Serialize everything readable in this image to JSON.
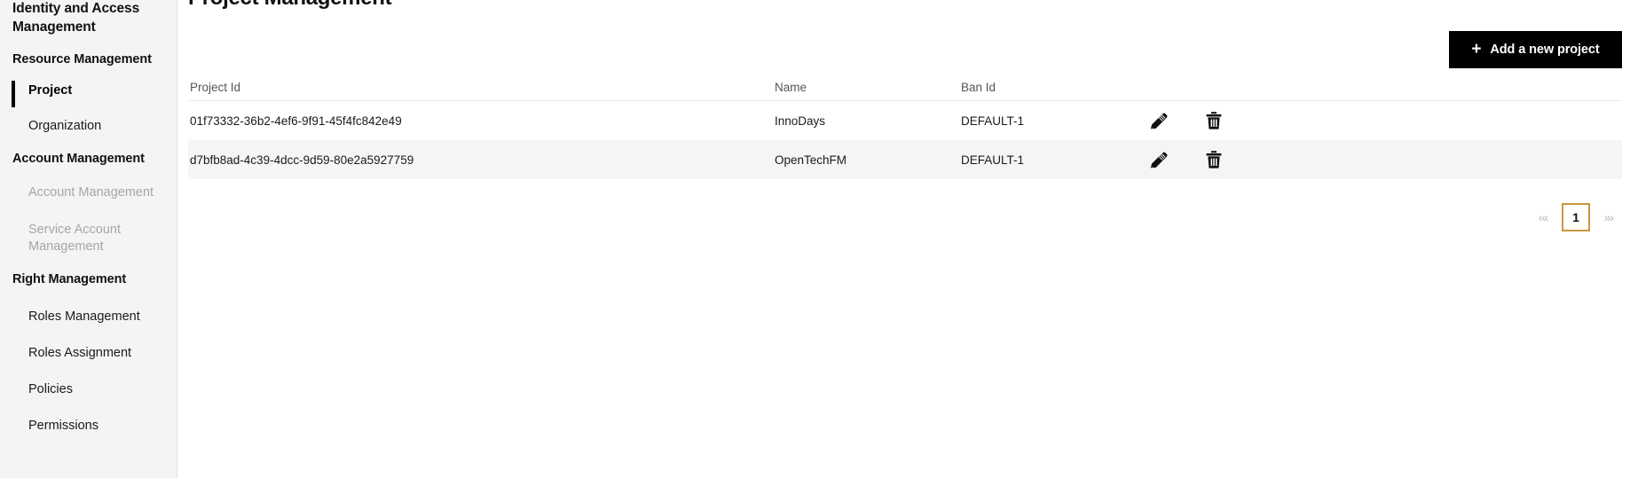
{
  "sidebar": {
    "title": "Identity and Access Management",
    "sections": [
      {
        "label": "Resource Management",
        "items": [
          {
            "label": "Project",
            "state": "active"
          },
          {
            "label": "Organization",
            "state": "muted"
          }
        ]
      },
      {
        "label": "Account Management",
        "items": [
          {
            "label": "Account Management",
            "state": "disabled"
          },
          {
            "label": "Service Account Management",
            "state": "disabled"
          }
        ]
      },
      {
        "label": "Right Management",
        "items": [
          {
            "label": "Roles Management",
            "state": "normal"
          },
          {
            "label": "Roles Assignment",
            "state": "normal"
          },
          {
            "label": "Policies",
            "state": "normal"
          },
          {
            "label": "Permissions",
            "state": "normal"
          }
        ]
      }
    ]
  },
  "main": {
    "page_title": "Project Management",
    "add_button": {
      "label": "Add a new project",
      "icon": "plus-icon",
      "plus": "+",
      "background": "#000000",
      "color": "#ffffff"
    },
    "table": {
      "columns": [
        "Project Id",
        "Name",
        "Ban Id"
      ],
      "rows": [
        {
          "project_id": "01f73332-36b2-4ef6-9f91-45f4fc842e49",
          "name": "InnoDays",
          "ban_id": "DEFAULT-1",
          "edit_icon": "pencil-icon",
          "delete_icon": "trash-icon"
        },
        {
          "project_id": "d7bfb8ad-4c39-4dcc-9d59-80e2a5927759",
          "name": "OpenTechFM",
          "ban_id": "DEFAULT-1",
          "edit_icon": "pencil-icon",
          "delete_icon": "trash-icon"
        }
      ]
    },
    "pagination": {
      "first_label": "‹«",
      "last_label": "»›",
      "pages": [
        "1"
      ],
      "current": "1",
      "accent": "#c8973f"
    }
  }
}
